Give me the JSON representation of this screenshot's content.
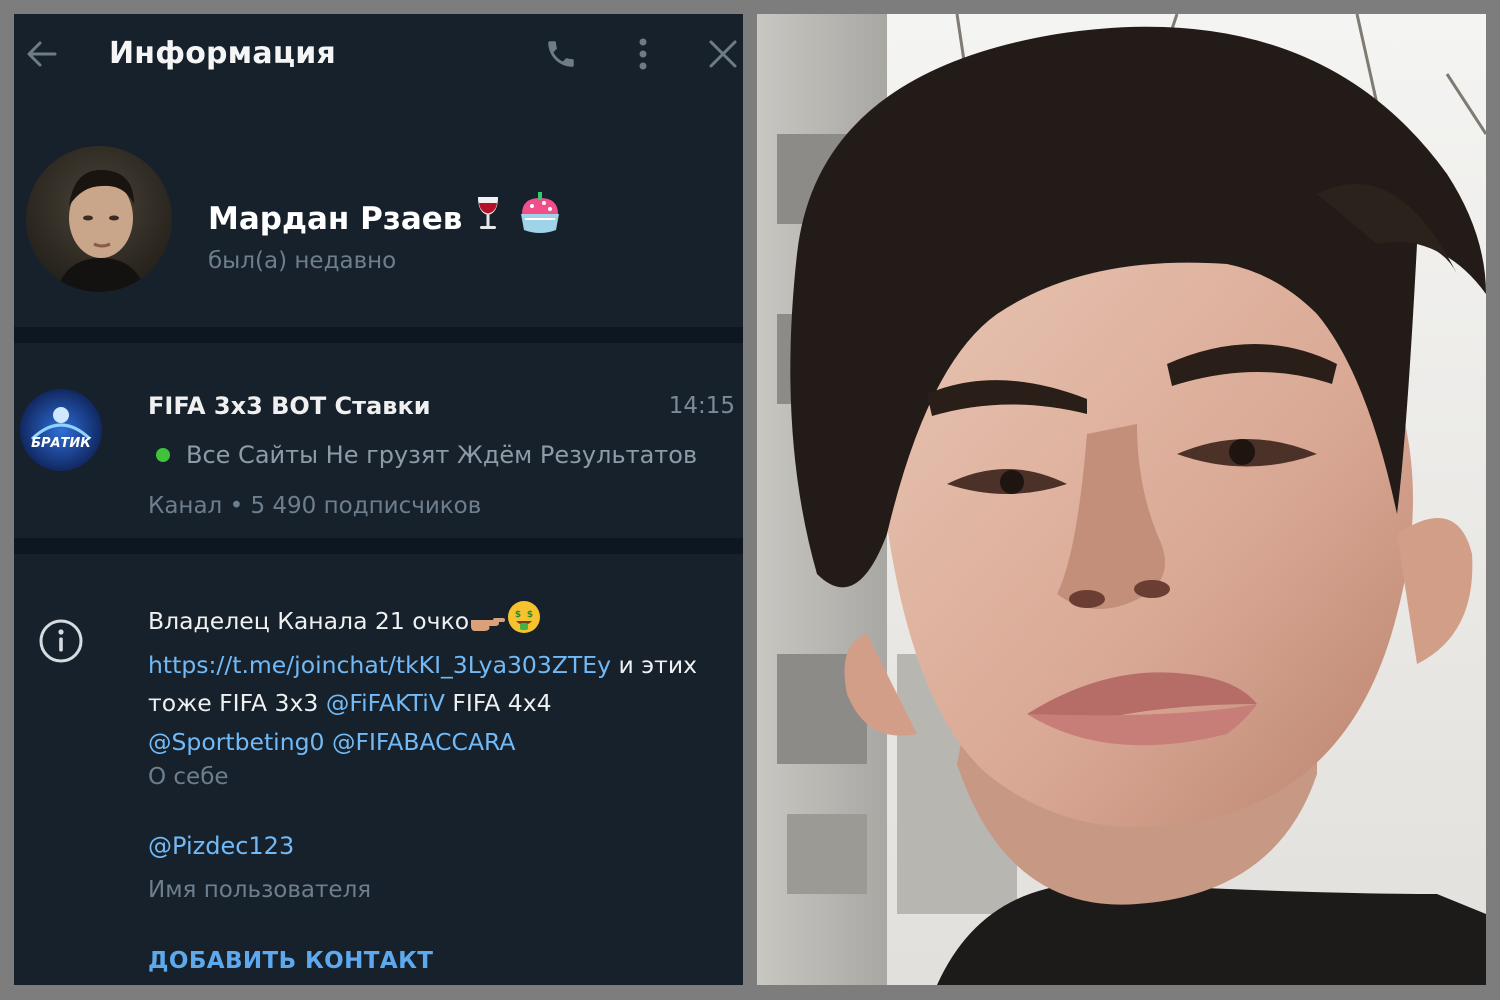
{
  "header": {
    "title": "Информация"
  },
  "profile": {
    "name": "Мардан Рзаев",
    "status": "был(а) недавно"
  },
  "channel": {
    "title": "FIFA 3x3 BOT Ставки",
    "time": "14:15",
    "last_message": "Все Сайты Не грузят Ждём Результатов",
    "meta": "Канал • 5 490 подписчиков",
    "avatar_text": "БРАТИК"
  },
  "bio": {
    "text_1": "Владелец Канала 21 очко",
    "link_1": "https://t.me/joinchat/tkKI_3Lya303ZTEy",
    "text_2": " и этих тоже FIFA 3x3 ",
    "mention_1": "@FiFAKTiV",
    "text_3": " FIFA 4x4 ",
    "mention_2": "@Sportbeting0",
    "mention_3": "@FIFABACCARA",
    "label": "О себе"
  },
  "username": {
    "value": "@Pizdec123",
    "label": "Имя пользователя"
  },
  "actions": {
    "add_contact": "ДОБАВИТЬ КОНТАКТ"
  },
  "icons": {
    "back": "arrow-left-icon",
    "call": "phone-icon",
    "more": "more-vertical-icon",
    "close": "close-icon",
    "info": "info-icon"
  },
  "colors": {
    "panel_bg": "#17212b",
    "divider": "#0e1621",
    "link": "#71baf7",
    "online": "#3fc33b",
    "frame": "#7d7d7d"
  }
}
